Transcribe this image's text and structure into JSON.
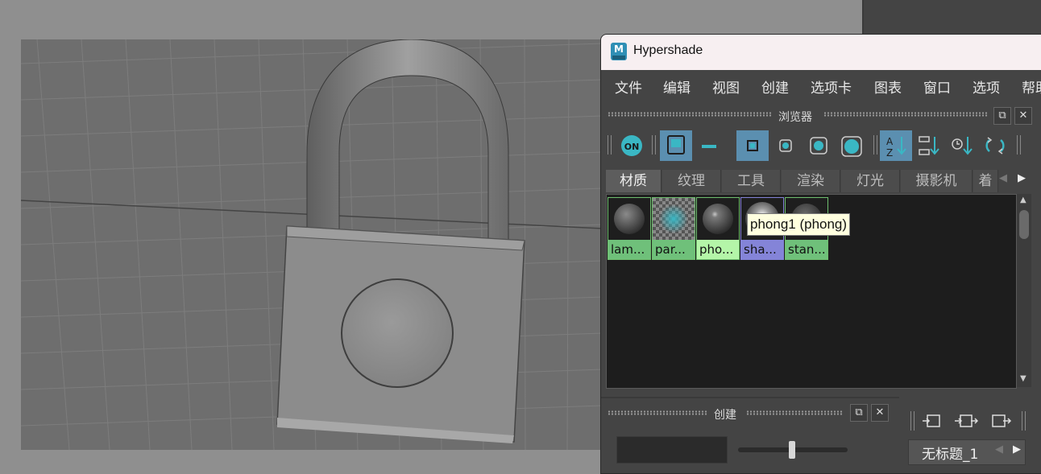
{
  "window": {
    "title": "Hypershade",
    "app_icon_letter": "M"
  },
  "menubar": {
    "items": [
      "文件",
      "编辑",
      "视图",
      "创建",
      "选项卡",
      "图表",
      "窗口",
      "选项",
      "帮助"
    ]
  },
  "browser": {
    "label": "浏览器",
    "toolbar": {
      "on_button_label": "ON"
    },
    "tabs": [
      "材质",
      "纹理",
      "工具",
      "渲染",
      "灯光",
      "摄影机",
      "着"
    ],
    "active_tab": "材质",
    "swatches": [
      {
        "label": "lam...",
        "color": "#6fc07a"
      },
      {
        "label": "par...",
        "color": "#6fc07a"
      },
      {
        "label": "pho...",
        "color": "#b4f5a8"
      },
      {
        "label": "sha...",
        "color": "#8484d8"
      },
      {
        "label": "stan...",
        "color": "#6fc07a"
      }
    ],
    "tooltip": "phong1 (phong)"
  },
  "create_panel": {
    "label": "创建",
    "graph_tab_label": "无标题_1"
  },
  "colors": {
    "active_button": "#5b8fb0",
    "icon_teal": "#3ab7c4",
    "title_bar": "#f7eff1"
  }
}
